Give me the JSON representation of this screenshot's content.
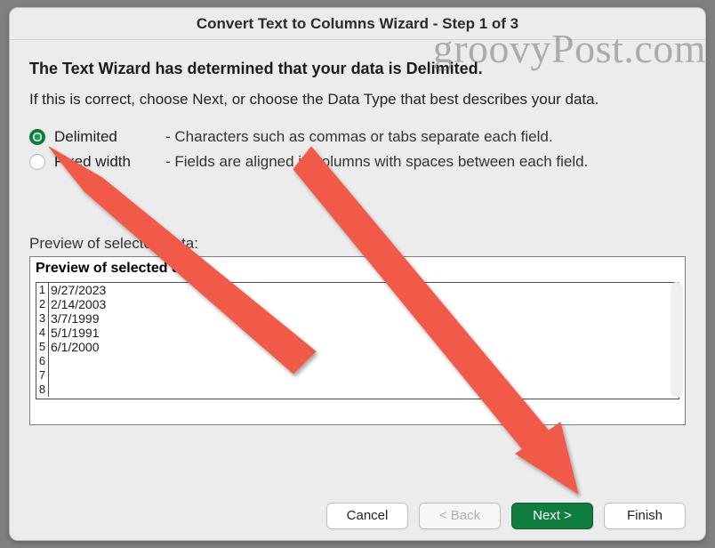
{
  "window": {
    "title": "Convert Text to Columns Wizard - Step 1 of 3"
  },
  "heading": "The Text Wizard has determined that your data is Delimited.",
  "subtext": "If this is correct, choose Next, or choose the Data Type that best describes your data.",
  "options": {
    "delimited": {
      "label": "Delimited",
      "desc": "-  Characters such as commas or tabs separate each field."
    },
    "fixedwidth": {
      "label": "Fixed width",
      "desc": "-  Fields are aligned in columns with spaces between each field."
    }
  },
  "preview": {
    "label": "Preview of selected data:",
    "box_title": "Preview of selected data:",
    "rows": [
      {
        "n": "1",
        "v": "9/27/2023"
      },
      {
        "n": "2",
        "v": "2/14/2003"
      },
      {
        "n": "3",
        "v": "3/7/1999"
      },
      {
        "n": "4",
        "v": "5/1/1991"
      },
      {
        "n": "5",
        "v": "6/1/2000"
      },
      {
        "n": "6",
        "v": ""
      },
      {
        "n": "7",
        "v": ""
      },
      {
        "n": "8",
        "v": ""
      }
    ]
  },
  "buttons": {
    "cancel": "Cancel",
    "back": "< Back",
    "next": "Next >",
    "finish": "Finish"
  },
  "watermark": "groovyPost.com"
}
